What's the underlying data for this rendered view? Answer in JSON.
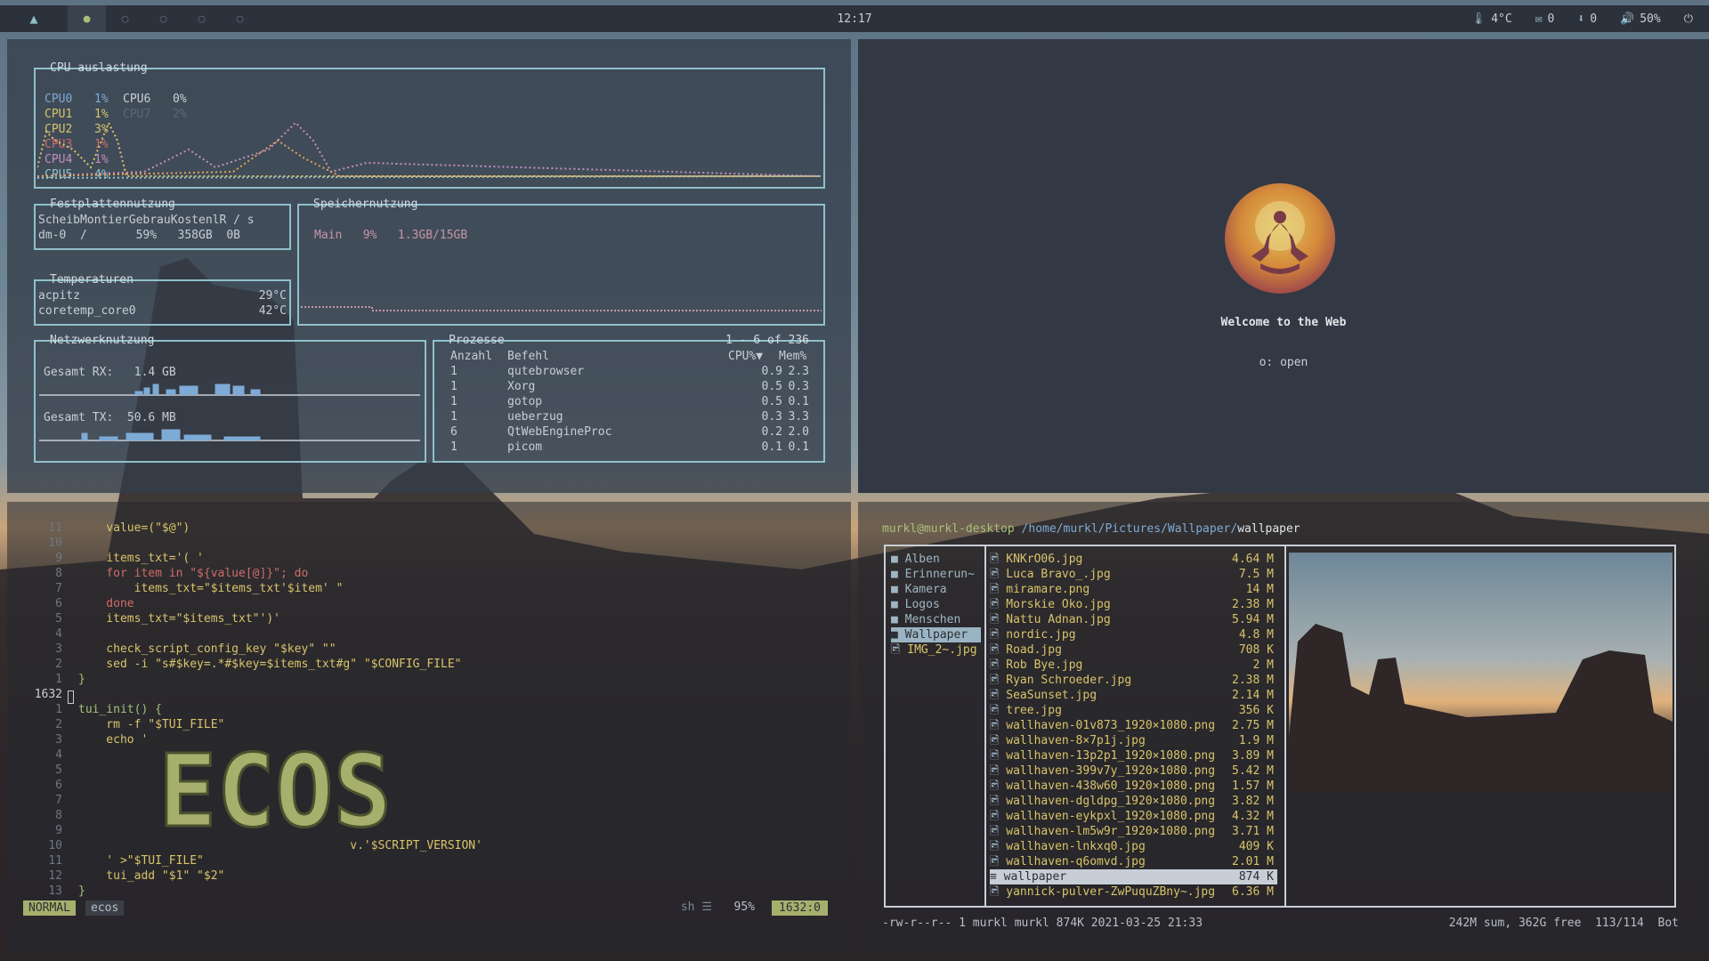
{
  "topbar": {
    "arch_icon": "arch-logo",
    "clock": "12:17",
    "temp": "4°C",
    "mail": "0",
    "updates": "0",
    "volume": "50%",
    "colors": {
      "active_ws": "#a6c07a",
      "bar": "#2b323c"
    }
  },
  "btop": {
    "cpu_title": "CPU auslastung",
    "cpus": [
      {
        "name": "CPU0",
        "val": "1%"
      },
      {
        "name": "CPU1",
        "val": "1%"
      },
      {
        "name": "CPU2",
        "val": "3%"
      },
      {
        "name": "CPU3",
        "val": "1%"
      },
      {
        "name": "CPU4",
        "val": "1%"
      },
      {
        "name": "CPU5",
        "val": "4%"
      }
    ],
    "cpus_right": [
      {
        "name": "CPU6",
        "val": "0%"
      },
      {
        "name": "CPU7",
        "val": "2%"
      }
    ],
    "disk_title": "Festplattennutzung",
    "disk_header": "ScheibMontierGebrauKostenlR / s",
    "disk_row": "dm-0  /       59%   358GB  0B",
    "temp_title": "Temperaturen",
    "temps": [
      {
        "name": "acpitz",
        "val": "29°C"
      },
      {
        "name": "coretemp_core0",
        "val": "42°C"
      }
    ],
    "mem_title": "Speichernutzung",
    "mem_row": "Main   9%   1.3GB/15GB",
    "net_title": "Netzwerknutzung",
    "rx": "Gesamt RX:   1.4 GB",
    "tx": "Gesamt TX:  50.6 MB",
    "proc_title": "Prozesse",
    "proc_range": "1 - 6 of 236",
    "proc_headers": [
      "Anzahl",
      "Befehl",
      "CPU%▼",
      "Mem%"
    ],
    "procs": [
      [
        "1",
        "qutebrowser",
        "0.9",
        "2.3"
      ],
      [
        "1",
        "Xorg",
        "0.5",
        "0.3"
      ],
      [
        "1",
        "gotop",
        "0.5",
        "0.1"
      ],
      [
        "1",
        "ueberzug",
        "0.3",
        "3.3"
      ],
      [
        "6",
        "QtWebEngineProc",
        "0.2",
        "2.0"
      ],
      [
        "1",
        "picom",
        "0.1",
        "0.1"
      ]
    ]
  },
  "qute": {
    "welcome": "Welcome to the Web",
    "hint": "o: open"
  },
  "vim": {
    "lines": [
      {
        "n": "11",
        "t": "    value=(\"$@\")"
      },
      {
        "n": "10",
        "t": ""
      },
      {
        "n": "9",
        "t": "    items_txt='( '"
      },
      {
        "n": "8",
        "t": "    for item in \"${value[@]}\"; do"
      },
      {
        "n": "7",
        "t": "        items_txt=\"$items_txt'$item' \""
      },
      {
        "n": "6",
        "t": "    done"
      },
      {
        "n": "5",
        "t": "    items_txt=\"$items_txt\"')'"
      },
      {
        "n": "4",
        "t": ""
      },
      {
        "n": "3",
        "t": "    check_script_config_key \"$key\" \"\""
      },
      {
        "n": "2",
        "t": "    sed -i \"s#$key=.*#$key=$items_txt#g\" \"$CONFIG_FILE\""
      },
      {
        "n": "1",
        "t": "}"
      },
      {
        "n": "1632",
        "t": ""
      },
      {
        "n": "1",
        "t": "tui_init() {"
      },
      {
        "n": "2",
        "t": "    rm -f \"$TUI_FILE\""
      },
      {
        "n": "3",
        "t": "    echo '"
      },
      {
        "n": "4",
        "t": ""
      },
      {
        "n": "5",
        "t": ""
      },
      {
        "n": "6",
        "t": ""
      },
      {
        "n": "7",
        "t": ""
      },
      {
        "n": "8",
        "t": ""
      },
      {
        "n": "9",
        "t": ""
      },
      {
        "n": "10",
        "t": "                                       v.'$SCRIPT_VERSION'"
      },
      {
        "n": "11",
        "t": "    ' >\"$TUI_FILE\""
      },
      {
        "n": "12",
        "t": "    tui_add \"$1\" \"$2\""
      },
      {
        "n": "13",
        "t": "}"
      }
    ],
    "banner": "ECOS",
    "mode": "NORMAL",
    "file": "ecos",
    "filetype": "sh",
    "percent": "95%",
    "position": "1632:0"
  },
  "lf": {
    "prompt_user": "murkl@murkl-desktop",
    "prompt_path": "/home/murkl/Pictures/Wallpaper/",
    "prompt_dir": "wallpaper",
    "dirs": [
      "Alben",
      "Erinnerun~",
      "Kamera",
      "Logos",
      "Menschen",
      "Wallpaper",
      "IMG_2~.jpg"
    ],
    "selected_dir": "Wallpaper",
    "files": [
      [
        "KNKrO06.jpg",
        "4.64 M"
      ],
      [
        "Luca Bravo_.jpg",
        "7.5 M"
      ],
      [
        "miramare.png",
        "14 M"
      ],
      [
        "Morskie Oko.jpg",
        "2.38 M"
      ],
      [
        "Nattu Adnan.jpg",
        "5.94 M"
      ],
      [
        "nordic.jpg",
        "4.8 M"
      ],
      [
        "Road.jpg",
        "708 K"
      ],
      [
        "Rob Bye.jpg",
        "2 M"
      ],
      [
        "Ryan Schroeder.jpg",
        "2.38 M"
      ],
      [
        "SeaSunset.jpg",
        "2.14 M"
      ],
      [
        "tree.jpg",
        "356 K"
      ],
      [
        "wallhaven-01v873_1920×1080.png",
        "2.75 M"
      ],
      [
        "wallhaven-8×7p1j.jpg",
        "1.9 M"
      ],
      [
        "wallhaven-13p2p1_1920×1080.png",
        "3.89 M"
      ],
      [
        "wallhaven-399v7y_1920×1080.png",
        "5.42 M"
      ],
      [
        "wallhaven-438w60_1920×1080.png",
        "1.57 M"
      ],
      [
        "wallhaven-dgldpg_1920×1080.png",
        "3.82 M"
      ],
      [
        "wallhaven-eykpxl_1920×1080.png",
        "4.32 M"
      ],
      [
        "wallhaven-lm5w9r_1920×1080.png",
        "3.71 M"
      ],
      [
        "wallhaven-lnkxq0.jpg",
        "409 K"
      ],
      [
        "wallhaven-q6omvd.jpg",
        "2.01 M"
      ],
      [
        "wallpaper",
        "874 K"
      ],
      [
        "yannick-pulver-ZwPuquZBny~.jpg",
        "6.36 M"
      ]
    ],
    "selected_file": "wallpaper",
    "status_left": "-rw-r--r-- 1 murkl murkl 874K 2021-03-25 21:33",
    "status_right": "242M sum, 362G free  113/114  Bot"
  }
}
